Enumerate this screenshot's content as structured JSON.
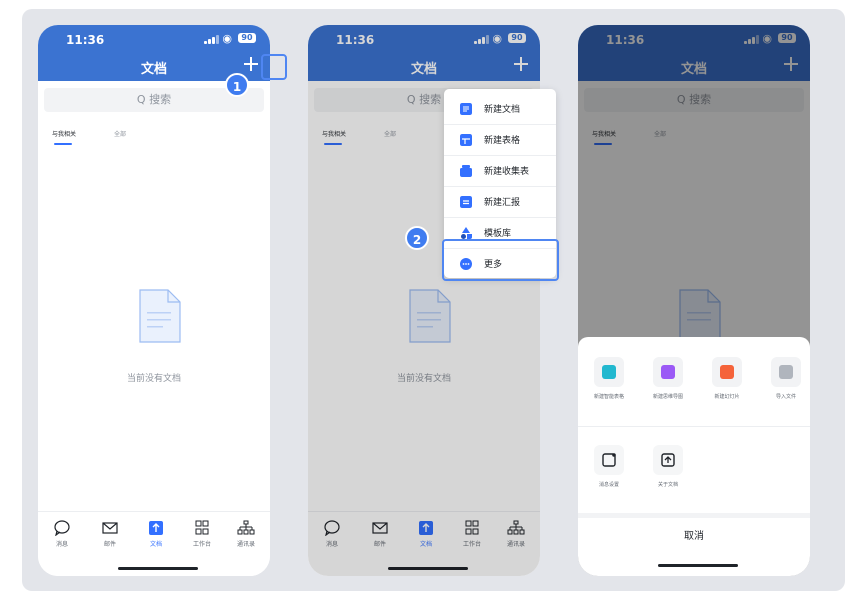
{
  "status": {
    "time": "11:36",
    "battery": "90"
  },
  "header": {
    "title": "文档"
  },
  "search": {
    "placeholder": "Q 搜索"
  },
  "tabs": {
    "active": "与我相关",
    "inactive": "全部"
  },
  "empty": {
    "text": "当前没有文档"
  },
  "bottom_nav": [
    {
      "label": "消息",
      "icon": "chat-bubble-icon"
    },
    {
      "label": "邮件",
      "icon": "mail-icon"
    },
    {
      "label": "文档",
      "icon": "docs-icon"
    },
    {
      "label": "工作台",
      "icon": "grid-icon"
    },
    {
      "label": "通讯录",
      "icon": "org-chart-icon"
    }
  ],
  "badges": [
    "1",
    "2"
  ],
  "menu": [
    {
      "label": "新建文档",
      "icon": "doc-icon",
      "color": "#3370ff"
    },
    {
      "label": "新建表格",
      "icon": "sheet-icon",
      "color": "#3370ff"
    },
    {
      "label": "新建收集表",
      "icon": "form-icon",
      "color": "#3370ff"
    },
    {
      "label": "新建汇报",
      "icon": "report-icon",
      "color": "#3370ff"
    },
    {
      "label": "模板库",
      "icon": "template-icon",
      "color": "#3370ff"
    },
    {
      "label": "更多",
      "icon": "more-icon",
      "color": "#3370ff"
    }
  ],
  "sheet": {
    "row1": [
      {
        "label": "新建智能表格",
        "icon": "smart-sheet-icon",
        "color": "#22b8cf"
      },
      {
        "label": "新建思维导图",
        "icon": "mindmap-icon",
        "color": "#9b59f6"
      },
      {
        "label": "新建幻灯片",
        "icon": "slides-icon",
        "color": "#f5633a"
      },
      {
        "label": "导入文件",
        "icon": "import-icon",
        "color": "#8f959e"
      }
    ],
    "row2": [
      {
        "label": "消息设置",
        "icon": "settings-square-icon",
        "color": "#1f2329"
      },
      {
        "label": "关于文档",
        "icon": "about-doc-icon",
        "color": "#1f2329"
      }
    ],
    "cancel": "取消"
  },
  "colors": {
    "accent": "#3b73d1",
    "highlight": "#4f86f2"
  }
}
